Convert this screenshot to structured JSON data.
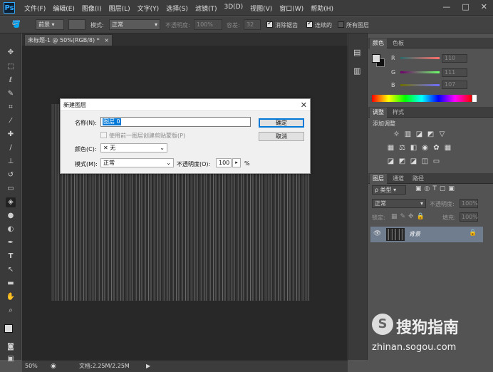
{
  "app": {
    "logo": "Ps"
  },
  "menu": [
    "文件(F)",
    "编辑(E)",
    "图像(I)",
    "图层(L)",
    "文字(Y)",
    "选择(S)",
    "滤镜(T)",
    "3D(D)",
    "视图(V)",
    "窗口(W)",
    "帮助(H)"
  ],
  "window_controls": {
    "minimize": "—",
    "restore": "□",
    "close": "✕"
  },
  "options": {
    "fill_source": "前景",
    "mode_label": "模式:",
    "mode_value": "正常",
    "opacity_label": "不透明度:",
    "opacity_value": "100%",
    "tolerance_label": "容差:",
    "tolerance_value": "32",
    "antialias_label": "消除锯齿",
    "contiguous_label": "连续的",
    "all_layers_label": "所有图层"
  },
  "document": {
    "tab_title": "未标题-1 @ 50%(RGB/8) *",
    "close": "×",
    "zoom": "50%",
    "doc_info": "文档:2.25M/2.25M"
  },
  "color_panel": {
    "tabs": [
      "颜色",
      "色板"
    ],
    "r_label": "R",
    "g_label": "G",
    "b_label": "B",
    "r_value": "110",
    "g_value": "111",
    "b_value": "107"
  },
  "adjust_panel": {
    "tabs": [
      "调整",
      "样式"
    ],
    "add_label": "添加调整"
  },
  "layers_panel": {
    "tabs": [
      "图层",
      "通道",
      "路径"
    ],
    "kind_label": "ρ 类型",
    "blend_mode": "正常",
    "opacity_label": "不透明度:",
    "opacity_value": "100%",
    "lock_label": "锁定:",
    "fill_label": "填充:",
    "fill_value": "100%",
    "layer_name": "背景"
  },
  "dialog": {
    "title": "新建图层",
    "close": "✕",
    "name_label": "名称(N):",
    "name_value": "图层 0",
    "clip_label": "使用前一图层创建剪贴蒙版(P)",
    "color_label": "颜色(C):",
    "color_value": "✕ 无",
    "mode_label": "模式(M):",
    "mode_value": "正常",
    "opacity_label": "不透明度(O):",
    "opacity_value": "100",
    "percent": "%",
    "ok_label": "确定",
    "cancel_label": "取消"
  },
  "watermark": {
    "brand": "搜狗指南",
    "url": "zhinan.sogou.com"
  }
}
